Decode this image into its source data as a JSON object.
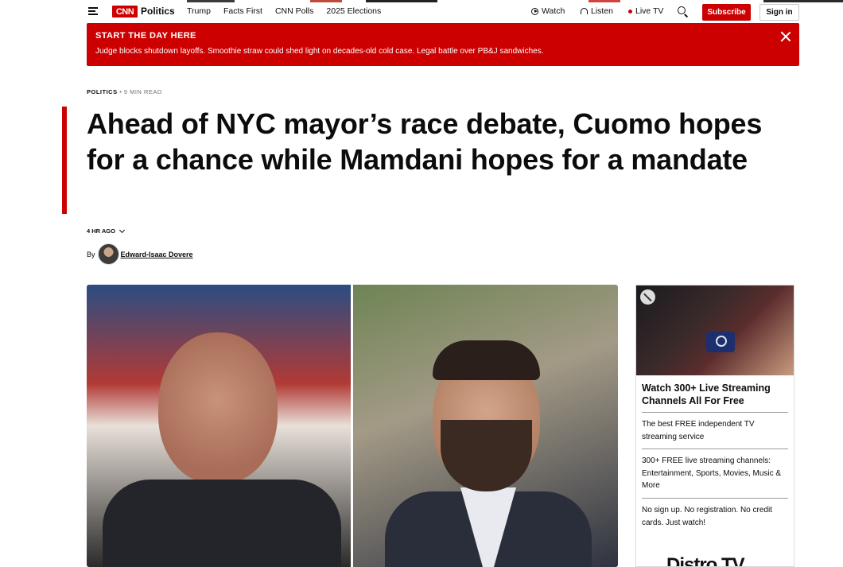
{
  "header": {
    "logo_text": "CNN",
    "section": "Politics",
    "nav": [
      "Trump",
      "Facts First",
      "CNN Polls",
      "2025 Elections"
    ],
    "watch": "Watch",
    "listen": "Listen",
    "live_tv": "Live TV",
    "subscribe": "Subscribe",
    "sign_in": "Sign in",
    "brand_color": "#cc0000"
  },
  "banner": {
    "kicker": "START THE DAY HERE",
    "text": "Judge blocks shutdown layoffs. Smoothie straw could shed light on decades-old cold case. Legal battle over PB&J sandwiches."
  },
  "article": {
    "section": "POLITICS",
    "separator": "•",
    "read_time": "9 MIN READ",
    "headline": "Ahead of NYC mayor’s race debate, Cuomo hopes for a chance while Mamdani hopes for a mandate",
    "timestamp": "4 HR AGO",
    "by": "By",
    "author": "Edward-Isaac Dovere"
  },
  "ad": {
    "title": "Watch 300+ Live Streaming Channels All For Free",
    "items": [
      "The best FREE independent TV streaming service",
      "300+ FREE live streaming channels: Entertainment, Sports, Movies, Music & More",
      "No sign up. No registration. No credit cards. Just watch!"
    ],
    "logo_text": "Distro TV"
  }
}
